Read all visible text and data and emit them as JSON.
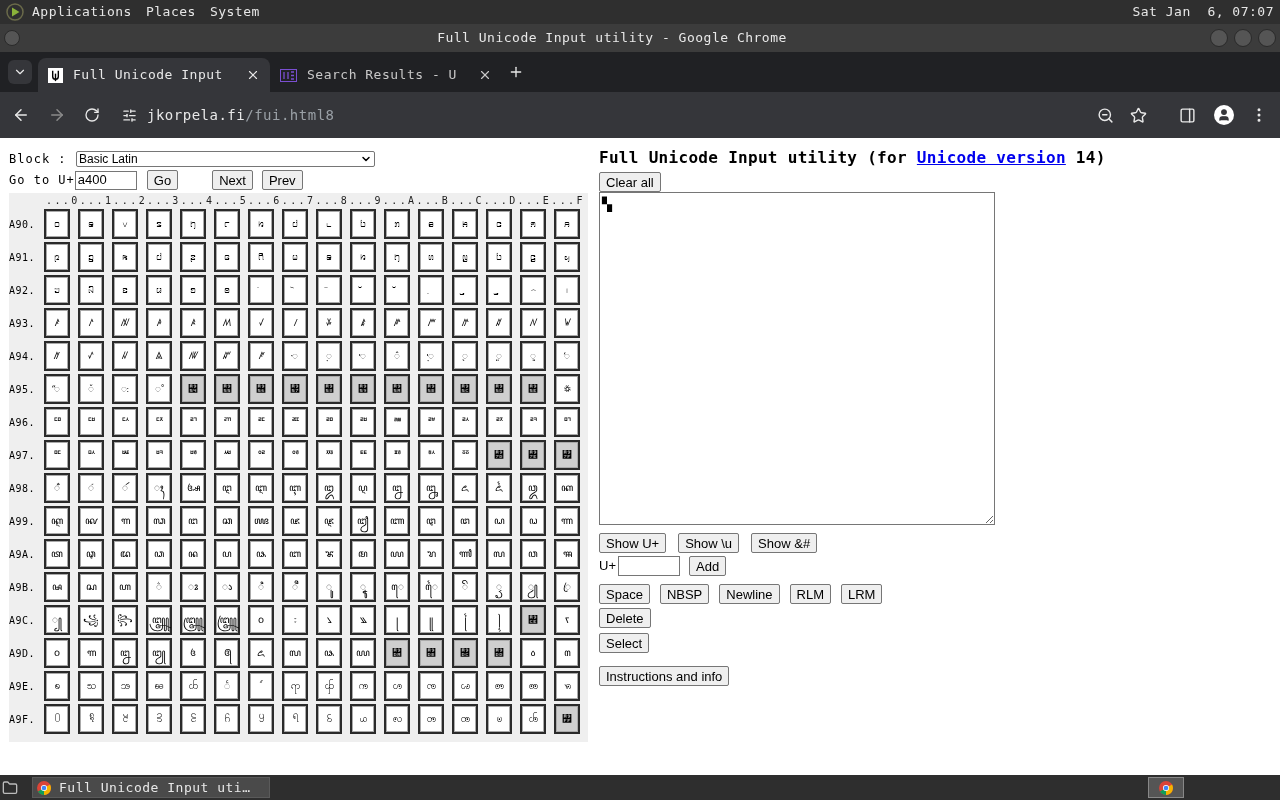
{
  "desktop_panel": {
    "menus": [
      "Applications",
      "Places",
      "System"
    ],
    "clock": "Sat Jan  6, 07:07"
  },
  "window": {
    "title": "Full Unicode Input utility - Google Chrome"
  },
  "tabs": [
    {
      "label": "Full Unicode Input",
      "selected": true
    },
    {
      "label": "Search Results - U",
      "selected": false
    }
  ],
  "address_bar": {
    "domain": "jkorpela.fi",
    "path": "/fui.html8"
  },
  "page": {
    "block_label": "Block :",
    "block_value": "Basic Latin",
    "goto_label": "Go to U+",
    "goto_value": "a400",
    "nav_buttons": [
      "Go",
      "Next",
      "Prev"
    ],
    "grid": {
      "column_header": "...0...1...2...3...4...5...6...7...8...9...A...B...C...D...E...F",
      "rows": [
        {
          "label": "A90.",
          "cells": [
            {
              "char": "꤀",
              "unassigned": false
            },
            {
              "char": "꤁",
              "unassigned": false
            },
            {
              "char": "꤂",
              "unassigned": false
            },
            {
              "char": "꤃",
              "unassigned": false
            },
            {
              "char": "꤄",
              "unassigned": false
            },
            {
              "char": "꤅",
              "unassigned": false
            },
            {
              "char": "꤆",
              "unassigned": false
            },
            {
              "char": "꤇",
              "unassigned": false
            },
            {
              "char": "꤈",
              "unassigned": false
            },
            {
              "char": "꤉",
              "unassigned": false
            },
            {
              "char": "ꤊ",
              "unassigned": false
            },
            {
              "char": "ꤋ",
              "unassigned": false
            },
            {
              "char": "ꤌ",
              "unassigned": false
            },
            {
              "char": "ꤍ",
              "unassigned": false
            },
            {
              "char": "ꤎ",
              "unassigned": false
            },
            {
              "char": "ꤏ",
              "unassigned": false
            }
          ]
        },
        {
          "label": "A91.",
          "cells": [
            {
              "char": "ꤐ",
              "unassigned": false
            },
            {
              "char": "ꤑ",
              "unassigned": false
            },
            {
              "char": "ꤒ",
              "unassigned": false
            },
            {
              "char": "ꤓ",
              "unassigned": false
            },
            {
              "char": "ꤔ",
              "unassigned": false
            },
            {
              "char": "ꤕ",
              "unassigned": false
            },
            {
              "char": "ꤖ",
              "unassigned": false
            },
            {
              "char": "ꤗ",
              "unassigned": false
            },
            {
              "char": "ꤘ",
              "unassigned": false
            },
            {
              "char": "ꤙ",
              "unassigned": false
            },
            {
              "char": "ꤚ",
              "unassigned": false
            },
            {
              "char": "ꤛ",
              "unassigned": false
            },
            {
              "char": "ꤜ",
              "unassigned": false
            },
            {
              "char": "ꤝ",
              "unassigned": false
            },
            {
              "char": "ꤞ",
              "unassigned": false
            },
            {
              "char": "ꤟ",
              "unassigned": false
            }
          ]
        },
        {
          "label": "A92.",
          "cells": [
            {
              "char": "ꤠ",
              "unassigned": false
            },
            {
              "char": "ꤡ",
              "unassigned": false
            },
            {
              "char": "ꤢ",
              "unassigned": false
            },
            {
              "char": "ꤣ",
              "unassigned": false
            },
            {
              "char": "ꤤ",
              "unassigned": false
            },
            {
              "char": "ꤥ",
              "unassigned": false
            },
            {
              "char": "ꤦ",
              "unassigned": false
            },
            {
              "char": "ꤧ",
              "unassigned": false
            },
            {
              "char": "ꤨ",
              "unassigned": false
            },
            {
              "char": "ꤩ",
              "unassigned": false
            },
            {
              "char": "ꤪ",
              "unassigned": false
            },
            {
              "char": "꤫",
              "unassigned": false
            },
            {
              "char": "꤬",
              "unassigned": false
            },
            {
              "char": "꤭",
              "unassigned": false
            },
            {
              "char": "꤮",
              "unassigned": false
            },
            {
              "char": "꤯",
              "unassigned": false
            }
          ]
        },
        {
          "label": "A93.",
          "cells": [
            {
              "char": "ꤰ",
              "unassigned": false
            },
            {
              "char": "ꤱ",
              "unassigned": false
            },
            {
              "char": "ꤲ",
              "unassigned": false
            },
            {
              "char": "ꤳ",
              "unassigned": false
            },
            {
              "char": "ꤴ",
              "unassigned": false
            },
            {
              "char": "ꤵ",
              "unassigned": false
            },
            {
              "char": "ꤶ",
              "unassigned": false
            },
            {
              "char": "ꤷ",
              "unassigned": false
            },
            {
              "char": "ꤸ",
              "unassigned": false
            },
            {
              "char": "ꤹ",
              "unassigned": false
            },
            {
              "char": "ꤺ",
              "unassigned": false
            },
            {
              "char": "ꤻ",
              "unassigned": false
            },
            {
              "char": "ꤼ",
              "unassigned": false
            },
            {
              "char": "ꤽ",
              "unassigned": false
            },
            {
              "char": "ꤾ",
              "unassigned": false
            },
            {
              "char": "ꤿ",
              "unassigned": false
            }
          ]
        },
        {
          "label": "A94.",
          "cells": [
            {
              "char": "ꥀ",
              "unassigned": false
            },
            {
              "char": "ꥁ",
              "unassigned": false
            },
            {
              "char": "ꥂ",
              "unassigned": false
            },
            {
              "char": "ꥃ",
              "unassigned": false
            },
            {
              "char": "ꥄ",
              "unassigned": false
            },
            {
              "char": "ꥅ",
              "unassigned": false
            },
            {
              "char": "ꥆ",
              "unassigned": false
            },
            {
              "char": "ꥇ",
              "unassigned": false
            },
            {
              "char": "ꥈ",
              "unassigned": false
            },
            {
              "char": "ꥉ",
              "unassigned": false
            },
            {
              "char": "ꥊ",
              "unassigned": false
            },
            {
              "char": "ꥋ",
              "unassigned": false
            },
            {
              "char": "ꥌ",
              "unassigned": false
            },
            {
              "char": "ꥍ",
              "unassigned": false
            },
            {
              "char": "ꥎ",
              "unassigned": false
            },
            {
              "char": "ꥏ",
              "unassigned": false
            }
          ]
        },
        {
          "label": "A95.",
          "cells": [
            {
              "char": "ꥐ",
              "unassigned": false
            },
            {
              "char": "ꥑ",
              "unassigned": false
            },
            {
              "char": "ꥒ",
              "unassigned": false
            },
            {
              "char": "꥓",
              "unassigned": false
            },
            {
              "char": "꥔",
              "unassigned": true
            },
            {
              "char": "꥕",
              "unassigned": true
            },
            {
              "char": "꥖",
              "unassigned": true
            },
            {
              "char": "꥗",
              "unassigned": true
            },
            {
              "char": "꥘",
              "unassigned": true
            },
            {
              "char": "꥙",
              "unassigned": true
            },
            {
              "char": "꥚",
              "unassigned": true
            },
            {
              "char": "꥛",
              "unassigned": true
            },
            {
              "char": "꥜",
              "unassigned": true
            },
            {
              "char": "꥝",
              "unassigned": true
            },
            {
              "char": "꥞",
              "unassigned": true
            },
            {
              "char": "꥟",
              "unassigned": false
            }
          ]
        },
        {
          "label": "A96.",
          "cells": [
            {
              "char": "ꥠ",
              "unassigned": false
            },
            {
              "char": "ꥡ",
              "unassigned": false
            },
            {
              "char": "ꥢ",
              "unassigned": false
            },
            {
              "char": "ꥣ",
              "unassigned": false
            },
            {
              "char": "ꥤ",
              "unassigned": false
            },
            {
              "char": "ꥥ",
              "unassigned": false
            },
            {
              "char": "ꥦ",
              "unassigned": false
            },
            {
              "char": "ꥧ",
              "unassigned": false
            },
            {
              "char": "ꥨ",
              "unassigned": false
            },
            {
              "char": "ꥩ",
              "unassigned": false
            },
            {
              "char": "ꥪ",
              "unassigned": false
            },
            {
              "char": "ꥫ",
              "unassigned": false
            },
            {
              "char": "ꥬ",
              "unassigned": false
            },
            {
              "char": "ꥭ",
              "unassigned": false
            },
            {
              "char": "ꥮ",
              "unassigned": false
            },
            {
              "char": "ꥯ",
              "unassigned": false
            }
          ]
        },
        {
          "label": "A97.",
          "cells": [
            {
              "char": "ꥰ",
              "unassigned": false
            },
            {
              "char": "ꥱ",
              "unassigned": false
            },
            {
              "char": "ꥲ",
              "unassigned": false
            },
            {
              "char": "ꥳ",
              "unassigned": false
            },
            {
              "char": "ꥴ",
              "unassigned": false
            },
            {
              "char": "ꥵ",
              "unassigned": false
            },
            {
              "char": "ꥶ",
              "unassigned": false
            },
            {
              "char": "ꥷ",
              "unassigned": false
            },
            {
              "char": "ꥸ",
              "unassigned": false
            },
            {
              "char": "ꥹ",
              "unassigned": false
            },
            {
              "char": "ꥺ",
              "unassigned": false
            },
            {
              "char": "ꥻ",
              "unassigned": false
            },
            {
              "char": "ꥼ",
              "unassigned": false
            },
            {
              "char": "꥽",
              "unassigned": true
            },
            {
              "char": "꥾",
              "unassigned": true
            },
            {
              "char": "꥿",
              "unassigned": true
            }
          ]
        },
        {
          "label": "A98.",
          "cells": [
            {
              "char": "ꦀ",
              "unassigned": false
            },
            {
              "char": "ꦁ",
              "unassigned": false
            },
            {
              "char": "ꦂ",
              "unassigned": false
            },
            {
              "char": "ꦃ",
              "unassigned": false
            },
            {
              "char": "ꦄ",
              "unassigned": false
            },
            {
              "char": "ꦅ",
              "unassigned": false
            },
            {
              "char": "ꦆ",
              "unassigned": false
            },
            {
              "char": "ꦇ",
              "unassigned": false
            },
            {
              "char": "ꦈ",
              "unassigned": false
            },
            {
              "char": "ꦉ",
              "unassigned": false
            },
            {
              "char": "ꦊ",
              "unassigned": false
            },
            {
              "char": "ꦋ",
              "unassigned": false
            },
            {
              "char": "ꦌ",
              "unassigned": false
            },
            {
              "char": "ꦍ",
              "unassigned": false
            },
            {
              "char": "ꦎ",
              "unassigned": false
            },
            {
              "char": "ꦏ",
              "unassigned": false
            }
          ]
        },
        {
          "label": "A99.",
          "cells": [
            {
              "char": "ꦐ",
              "unassigned": false
            },
            {
              "char": "ꦑ",
              "unassigned": false
            },
            {
              "char": "ꦒ",
              "unassigned": false
            },
            {
              "char": "ꦓ",
              "unassigned": false
            },
            {
              "char": "ꦔ",
              "unassigned": false
            },
            {
              "char": "ꦕ",
              "unassigned": false
            },
            {
              "char": "ꦖ",
              "unassigned": false
            },
            {
              "char": "ꦗ",
              "unassigned": false
            },
            {
              "char": "ꦘ",
              "unassigned": false
            },
            {
              "char": "ꦙ",
              "unassigned": false
            },
            {
              "char": "ꦚ",
              "unassigned": false
            },
            {
              "char": "ꦛ",
              "unassigned": false
            },
            {
              "char": "ꦜ",
              "unassigned": false
            },
            {
              "char": "ꦝ",
              "unassigned": false
            },
            {
              "char": "ꦞ",
              "unassigned": false
            },
            {
              "char": "ꦟ",
              "unassigned": false
            }
          ]
        },
        {
          "label": "A9A.",
          "cells": [
            {
              "char": "ꦠ",
              "unassigned": false
            },
            {
              "char": "ꦡ",
              "unassigned": false
            },
            {
              "char": "ꦢ",
              "unassigned": false
            },
            {
              "char": "ꦣ",
              "unassigned": false
            },
            {
              "char": "ꦤ",
              "unassigned": false
            },
            {
              "char": "ꦥ",
              "unassigned": false
            },
            {
              "char": "ꦦ",
              "unassigned": false
            },
            {
              "char": "ꦧ",
              "unassigned": false
            },
            {
              "char": "ꦨ",
              "unassigned": false
            },
            {
              "char": "ꦩ",
              "unassigned": false
            },
            {
              "char": "ꦪ",
              "unassigned": false
            },
            {
              "char": "ꦫ",
              "unassigned": false
            },
            {
              "char": "ꦬ",
              "unassigned": false
            },
            {
              "char": "ꦭ",
              "unassigned": false
            },
            {
              "char": "ꦮ",
              "unassigned": false
            },
            {
              "char": "ꦯ",
              "unassigned": false
            }
          ]
        },
        {
          "label": "A9B.",
          "cells": [
            {
              "char": "ꦰ",
              "unassigned": false
            },
            {
              "char": "ꦱ",
              "unassigned": false
            },
            {
              "char": "ꦲ",
              "unassigned": false
            },
            {
              "char": "꦳",
              "unassigned": false
            },
            {
              "char": "ꦴ",
              "unassigned": false
            },
            {
              "char": "ꦵ",
              "unassigned": false
            },
            {
              "char": "ꦶ",
              "unassigned": false
            },
            {
              "char": "ꦷ",
              "unassigned": false
            },
            {
              "char": "ꦸ",
              "unassigned": false
            },
            {
              "char": "ꦹ",
              "unassigned": false
            },
            {
              "char": "ꦺ",
              "unassigned": false
            },
            {
              "char": "ꦻ",
              "unassigned": false
            },
            {
              "char": "ꦼ",
              "unassigned": false
            },
            {
              "char": "ꦽ",
              "unassigned": false
            },
            {
              "char": "ꦾ",
              "unassigned": false
            },
            {
              "char": "ꦿ",
              "unassigned": false
            }
          ]
        },
        {
          "label": "A9C.",
          "cells": [
            {
              "char": "꧀",
              "unassigned": false
            },
            {
              "char": "꧁",
              "unassigned": false
            },
            {
              "char": "꧂",
              "unassigned": false
            },
            {
              "char": "꧃",
              "unassigned": false
            },
            {
              "char": "꧄",
              "unassigned": false
            },
            {
              "char": "꧅",
              "unassigned": false
            },
            {
              "char": "꧆",
              "unassigned": false
            },
            {
              "char": "꧇",
              "unassigned": false
            },
            {
              "char": "꧈",
              "unassigned": false
            },
            {
              "char": "꧉",
              "unassigned": false
            },
            {
              "char": "꧊",
              "unassigned": false
            },
            {
              "char": "꧋",
              "unassigned": false
            },
            {
              "char": "꧌",
              "unassigned": false
            },
            {
              "char": "꧍",
              "unassigned": false
            },
            {
              "char": "꧎",
              "unassigned": true
            },
            {
              "char": "ꧏ",
              "unassigned": false
            }
          ]
        },
        {
          "label": "A9D.",
          "cells": [
            {
              "char": "꧐",
              "unassigned": false
            },
            {
              "char": "꧑",
              "unassigned": false
            },
            {
              "char": "꧒",
              "unassigned": false
            },
            {
              "char": "꧓",
              "unassigned": false
            },
            {
              "char": "꧔",
              "unassigned": false
            },
            {
              "char": "꧕",
              "unassigned": false
            },
            {
              "char": "꧖",
              "unassigned": false
            },
            {
              "char": "꧗",
              "unassigned": false
            },
            {
              "char": "꧘",
              "unassigned": false
            },
            {
              "char": "꧙",
              "unassigned": false
            },
            {
              "char": "꧚",
              "unassigned": true
            },
            {
              "char": "꧛",
              "unassigned": true
            },
            {
              "char": "꧜",
              "unassigned": true
            },
            {
              "char": "꧝",
              "unassigned": true
            },
            {
              "char": "꧞",
              "unassigned": false
            },
            {
              "char": "꧟",
              "unassigned": false
            }
          ]
        },
        {
          "label": "A9E.",
          "cells": [
            {
              "char": "ꧠ",
              "unassigned": false
            },
            {
              "char": "ꧡ",
              "unassigned": false
            },
            {
              "char": "ꧢ",
              "unassigned": false
            },
            {
              "char": "ꧣ",
              "unassigned": false
            },
            {
              "char": "ꧤ",
              "unassigned": false
            },
            {
              "char": "ꧥ",
              "unassigned": false
            },
            {
              "char": "ꧦ",
              "unassigned": false
            },
            {
              "char": "ꧧ",
              "unassigned": false
            },
            {
              "char": "ꧨ",
              "unassigned": false
            },
            {
              "char": "ꧩ",
              "unassigned": false
            },
            {
              "char": "ꧪ",
              "unassigned": false
            },
            {
              "char": "ꧫ",
              "unassigned": false
            },
            {
              "char": "ꧬ",
              "unassigned": false
            },
            {
              "char": "ꧭ",
              "unassigned": false
            },
            {
              "char": "ꧮ",
              "unassigned": false
            },
            {
              "char": "ꧯ",
              "unassigned": false
            }
          ]
        },
        {
          "label": "A9F.",
          "cells": [
            {
              "char": "꧰",
              "unassigned": false
            },
            {
              "char": "꧱",
              "unassigned": false
            },
            {
              "char": "꧲",
              "unassigned": false
            },
            {
              "char": "꧳",
              "unassigned": false
            },
            {
              "char": "꧴",
              "unassigned": false
            },
            {
              "char": "꧵",
              "unassigned": false
            },
            {
              "char": "꧶",
              "unassigned": false
            },
            {
              "char": "꧷",
              "unassigned": false
            },
            {
              "char": "꧸",
              "unassigned": false
            },
            {
              "char": "꧹",
              "unassigned": false
            },
            {
              "char": "ꧺ",
              "unassigned": false
            },
            {
              "char": "ꧻ",
              "unassigned": false
            },
            {
              "char": "ꧼ",
              "unassigned": false
            },
            {
              "char": "ꧽ",
              "unassigned": false
            },
            {
              "char": "ꧾ",
              "unassigned": false
            },
            {
              "char": "꧿",
              "unassigned": true
            }
          ]
        }
      ]
    },
    "heading": {
      "text": "Full Unicode Input utility (for ",
      "link": "Unicode version",
      "after": " 14)"
    },
    "clear_button": "Clear all",
    "editor_value": "▚",
    "show_buttons": [
      "Show U+",
      "Show \\u",
      "Show &#"
    ],
    "add_label": "U+",
    "add_button": "Add",
    "insert_buttons": [
      "Space",
      "NBSP",
      "Newline",
      "RLM",
      "LRM"
    ],
    "delete_button": "Delete",
    "select_button": "Select",
    "info_button": "Instructions and info"
  },
  "taskbar": {
    "items": [
      {
        "label": "Full Unicode Input uti…"
      }
    ]
  }
}
